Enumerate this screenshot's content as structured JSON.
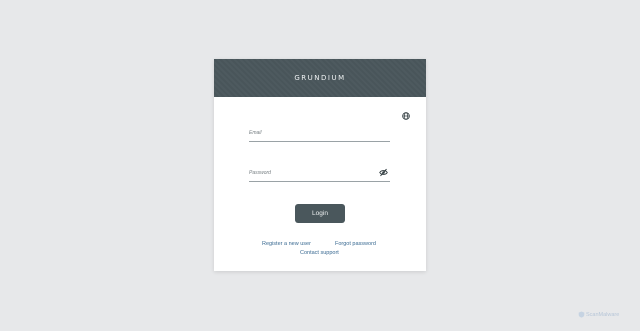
{
  "header": {
    "logo_text": "GRUNDIUM"
  },
  "language": {
    "icon": "globe-icon"
  },
  "form": {
    "email_placeholder": "Email",
    "email_value": "",
    "password_placeholder": "Password",
    "password_value": "",
    "password_toggle_icon": "eye-off-icon",
    "login_label": "Login"
  },
  "links": {
    "register": "Register a new user",
    "forgot": "Forgot password",
    "support": "Contact support"
  },
  "watermark": {
    "text": "ScanMalware"
  },
  "colors": {
    "background": "#e7e8ea",
    "header": "#4a575c",
    "button": "#4a575c",
    "link": "#3a6a92"
  }
}
